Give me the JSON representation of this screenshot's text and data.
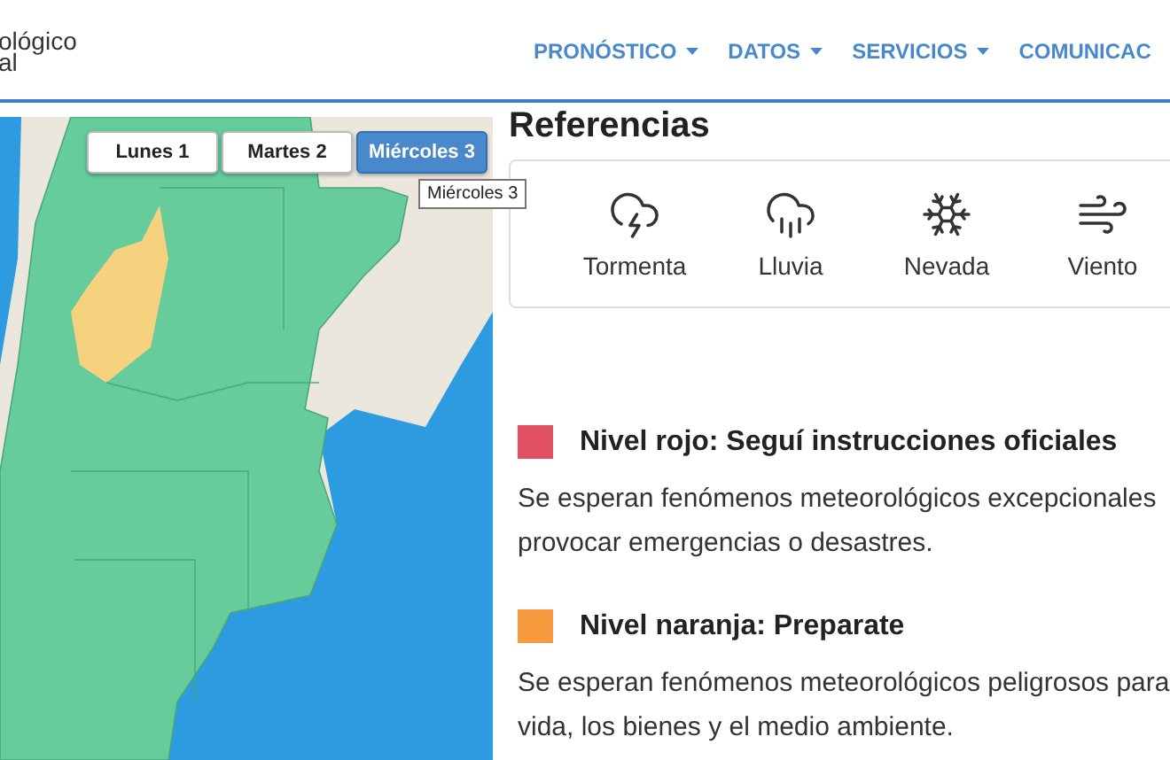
{
  "logo": {
    "lines": [
      "ológico",
      "al"
    ]
  },
  "nav": [
    {
      "label": "PRONÓSTICO",
      "caret": true
    },
    {
      "label": "DATOS",
      "caret": true
    },
    {
      "label": "SERVICIOS",
      "caret": true
    },
    {
      "label": "COMUNICAC",
      "caret": false
    }
  ],
  "map": {
    "tabs": [
      {
        "label": "Lunes 1",
        "selected": false
      },
      {
        "label": "Martes 2",
        "selected": false
      },
      {
        "label": "Miércoles 3",
        "selected": true
      }
    ],
    "tooltip": "Miércoles 3"
  },
  "references": {
    "title": "Referencias",
    "phenomena": [
      {
        "kind": "storm",
        "label": "Tormenta"
      },
      {
        "kind": "rain",
        "label": "Lluvia"
      },
      {
        "kind": "snow",
        "label": "Nevada"
      },
      {
        "kind": "wind",
        "label": "Viento"
      }
    ],
    "levels": [
      {
        "color": "#e05263",
        "title": "Nivel rojo: Seguí instrucciones oficiales",
        "lines": [
          "Se esperan fenómenos meteorológicos excepcionales",
          "provocar emergencias o desastres."
        ]
      },
      {
        "color": "#f79a3e",
        "title": "Nivel naranja: Preparate",
        "lines": [
          "Se esperan fenómenos meteorológicos peligrosos para",
          "vida, los bienes y el medio ambiente."
        ]
      }
    ]
  }
}
